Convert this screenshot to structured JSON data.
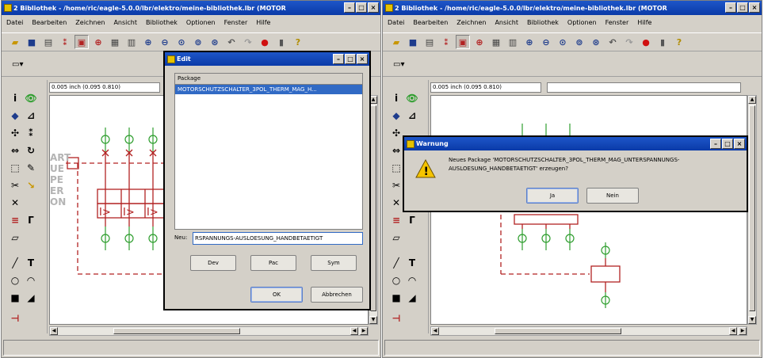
{
  "left_window": {
    "title": "2 Bibliothek - /home/ric/eagle-5.0.0/lbr/elektro/meine-bibliothek.lbr (MOTOR",
    "menu": [
      "Datei",
      "Bearbeiten",
      "Zeichnen",
      "Ansicht",
      "Bibliothek",
      "Optionen",
      "Fenster",
      "Hilfe"
    ],
    "coord": "0.005 inch (0.095 0.810)",
    "ghost_labels": [
      "ART",
      "UE",
      "PE",
      "ER",
      "ON"
    ]
  },
  "right_window": {
    "title": "2 Bibliothek - /home/ric/eagle-5.0.0/lbr/elektro/meine-bibliothek.lbr (MOTOR",
    "menu": [
      "Datei",
      "Bearbeiten",
      "Zeichnen",
      "Ansicht",
      "Bibliothek",
      "Optionen",
      "Fenster",
      "Hilfe"
    ],
    "coord": "0.005 inch (0.095 0.810)"
  },
  "edit_dialog": {
    "title": "Edit",
    "list_header": "Package",
    "list_item": "MOTORSCHUTZSCHALTER_3POL_THERM_MAG_H...",
    "new_label": "Neu:",
    "new_value": "RSPANNUNGS-AUSLOESUNG_HANDBETAETIGT",
    "btn_dev": "Dev",
    "btn_pac": "Pac",
    "btn_sym": "Sym",
    "btn_ok": "OK",
    "btn_cancel": "Abbrechen"
  },
  "warn_dialog": {
    "title": "Warnung",
    "message": "Neues Package 'MOTORSCHUTZSCHALTER_3POL_THERM_MAG_UNTERSPANNUNGS-AUSLOESUNG_HANDBETAETIGT' erzeugen?",
    "btn_yes": "Ja",
    "btn_no": "Nein"
  },
  "colors": {
    "titlebar": "#0a3aa8",
    "selection": "#316ac5",
    "schematic_red": "#b22222",
    "pin_green": "#2e9e2e"
  },
  "icons": [
    "open-icon",
    "save-icon",
    "print-icon",
    "zoom-in-icon",
    "zoom-out-icon",
    "undo-icon",
    "redo-icon",
    "stop-icon",
    "help-icon",
    "info-icon",
    "move-icon",
    "wire-icon",
    "text-icon",
    "circle-icon",
    "rect-icon",
    "delete-icon",
    "warning-icon"
  ]
}
